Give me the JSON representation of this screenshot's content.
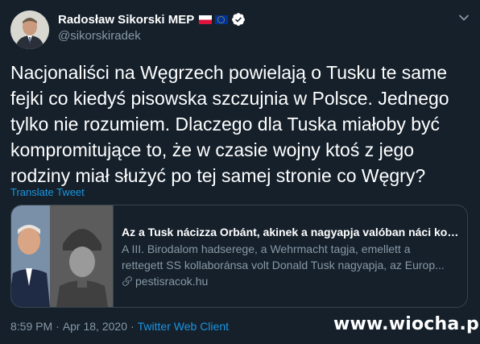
{
  "author": {
    "display_name": "Radosław Sikorski MEP",
    "handle": "@sikorskiradek",
    "flags": [
      "poland-flag-icon",
      "eu-flag-icon"
    ],
    "verified_icon": "verified-badge-icon"
  },
  "tweet": {
    "lines": [
      "Nacjonaliści na Węgrzech powielają o Tusku te same",
      "fejki co kiedyś pisowska szczujnia w Polsce. Jednego",
      "tylko nie rozumiem. Dlaczego dla Tuska miałoby być",
      "kompromitujące to, że w czasie wojny ktoś z jego",
      "rodziny miał służyć po tej samej stronie co Węgry?"
    ],
    "translate_label": "Translate Tweet"
  },
  "card": {
    "title": "Az a Tusk nácizza Orbánt, akinek a nagyapja valóban náci koll...",
    "description_lines": [
      "A III. Birodalom hadserege, a Wehrmacht tagja, emellett a",
      "rettegett SS kollaboránsa volt Donald Tusk nagyapja, az Europ..."
    ],
    "domain": "pestisracok.hu",
    "link_icon": "link-icon"
  },
  "meta": {
    "time": "8:59 PM",
    "separator": "·",
    "date": "Apr 18, 2020",
    "source": "Twitter Web Client"
  },
  "watermark": "www.wiocha.pl",
  "colors": {
    "background": "#15202b",
    "text": "#ffffff",
    "secondary": "#8899a6",
    "link": "#1b95e0",
    "border": "#38444d"
  }
}
